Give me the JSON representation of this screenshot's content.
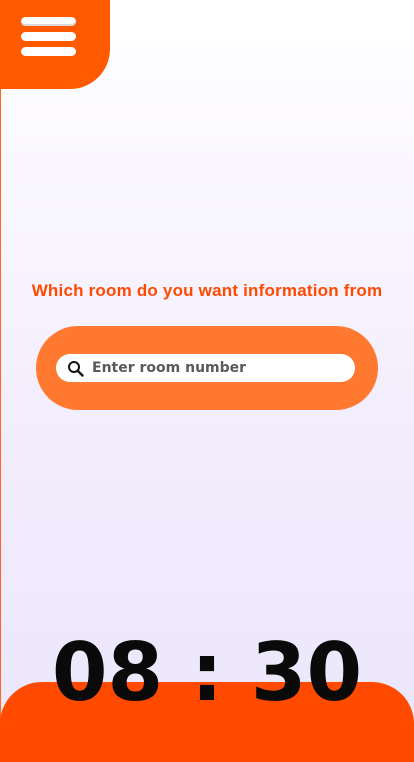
{
  "header": {
    "menu_icon": "hamburger-menu-icon"
  },
  "main": {
    "prompt": "Which room do you want information from",
    "search": {
      "icon": "search-icon",
      "placeholder": "Enter room number",
      "value": ""
    }
  },
  "footer": {
    "clock": "08 : 30"
  },
  "colors": {
    "accent": "#ff5a00",
    "search_pill": "#ff7a30",
    "prompt_text": "#ff4a00"
  }
}
